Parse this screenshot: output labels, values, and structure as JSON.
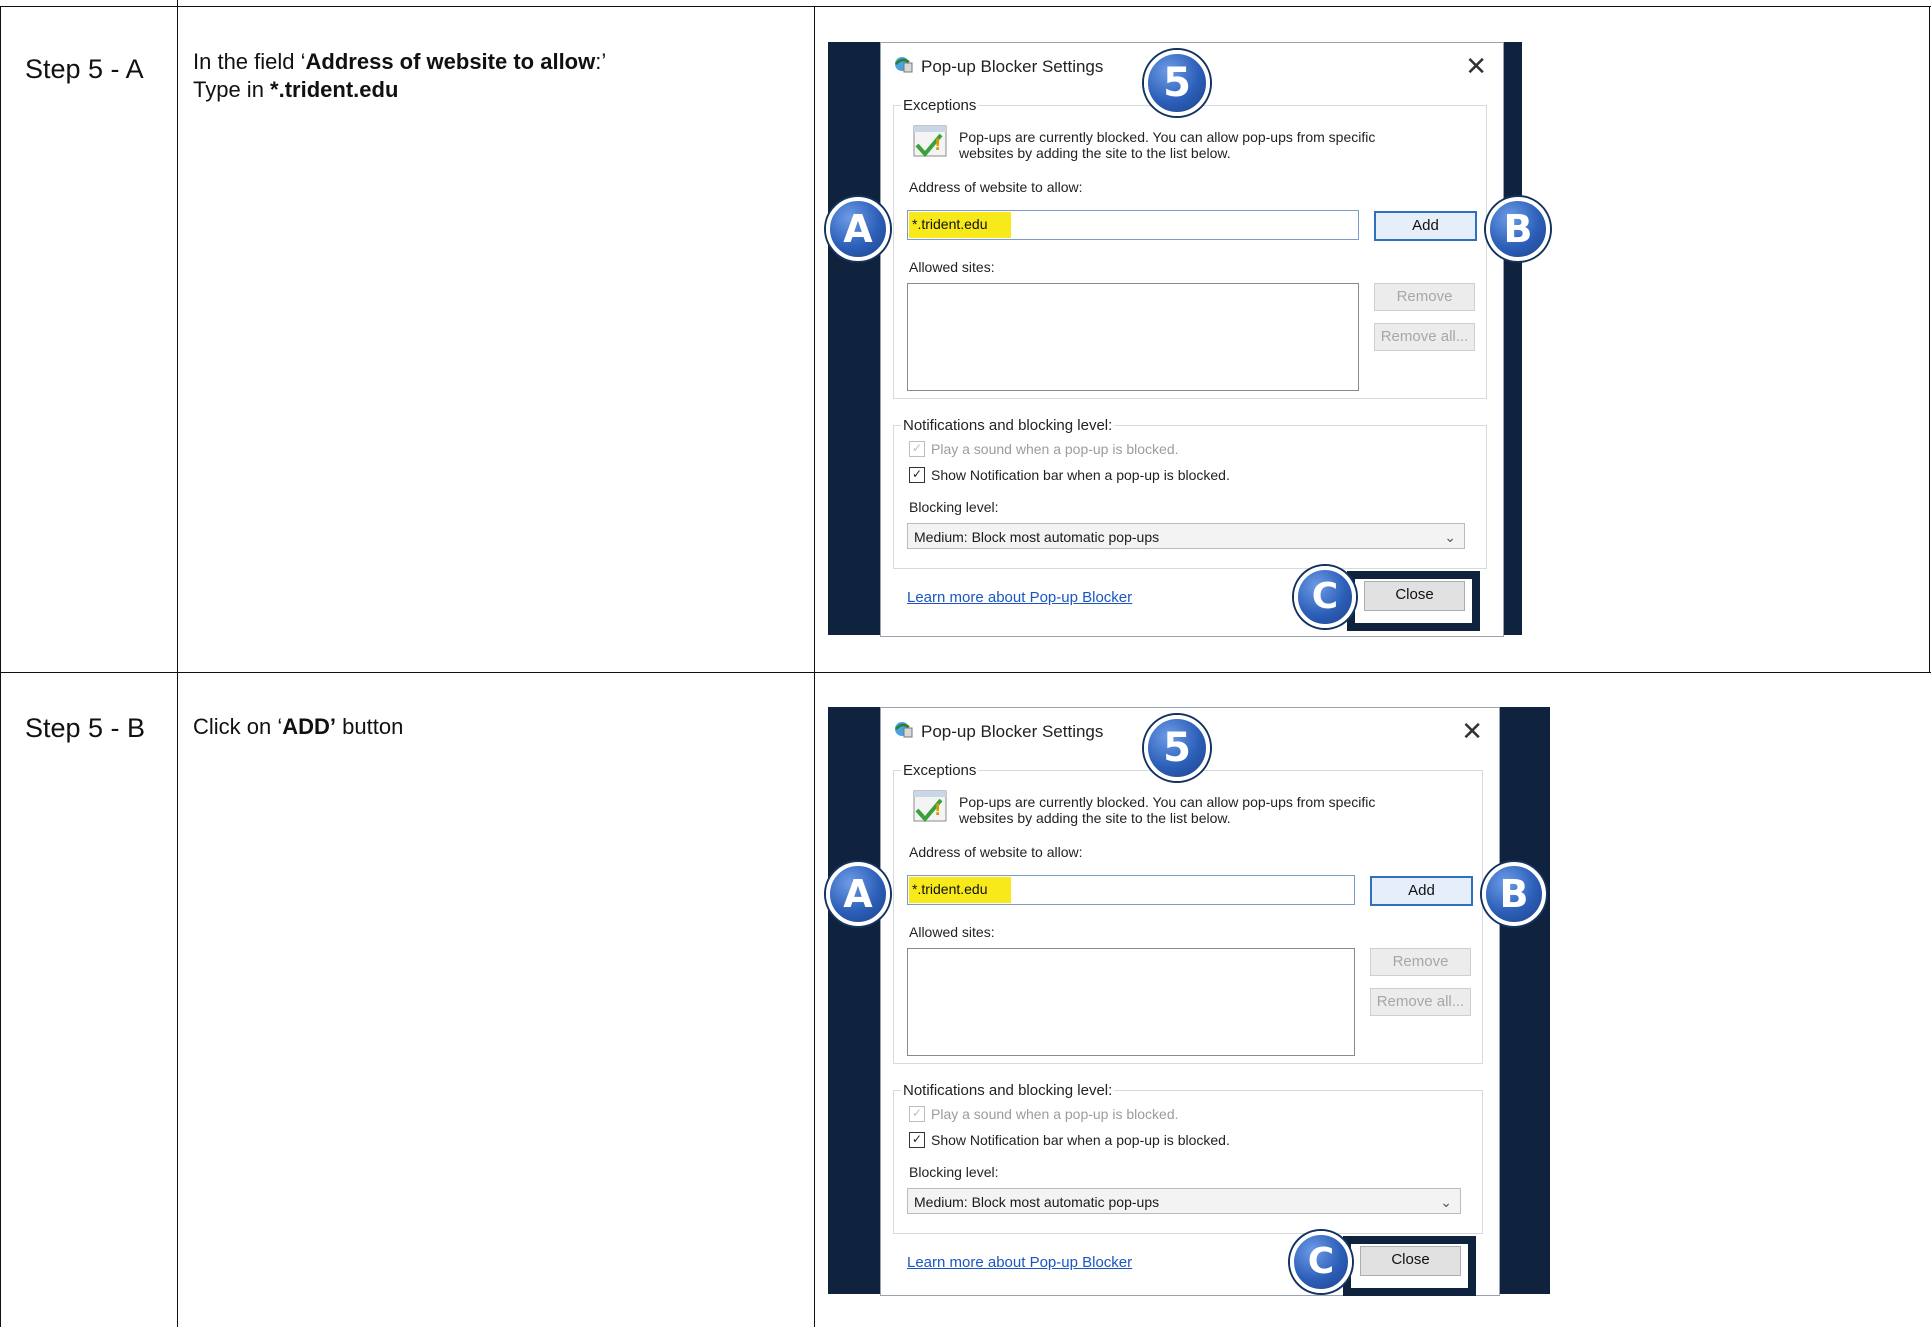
{
  "rows": [
    {
      "step": "Step 5 - A",
      "instr_line1_prefix": "In the field ‘",
      "instr_line1_bold": "Address of website to allow",
      "instr_line1_suffix": ":’",
      "instr_line2_prefix": "Type in ",
      "instr_line2_bold": "*.trident.edu"
    },
    {
      "step": "Step 5 - B",
      "instr_prefix": "Click on ‘",
      "instr_bold": "ADD’",
      "instr_suffix": " button"
    }
  ],
  "dialog": {
    "title": "Pop-up Blocker Settings",
    "close_glyph": "✕",
    "exceptions_label": "Exceptions",
    "info_line1": "Pop-ups are currently blocked.  You can allow pop-ups from specific",
    "info_line2": "websites by adding the site to the list below.",
    "address_label": "Address of website to allow:",
    "address_value": "*.trident.edu",
    "add_button": "Add",
    "allowed_sites_label": "Allowed sites:",
    "remove_button": "Remove",
    "remove_all_button": "Remove all...",
    "notifications_label": "Notifications and blocking level:",
    "play_sound_label": "Play a sound when a pop-up is blocked.",
    "show_notification_label": "Show Notification bar when a pop-up is blocked.",
    "blocking_level_label": "Blocking level:",
    "blocking_level_value": "Medium: Block most automatic pop-ups",
    "learn_more_link": "Learn more about Pop-up Blocker",
    "close_button": "Close",
    "checkmark": "✓",
    "chevron": "⌵"
  },
  "badges": {
    "step": "5",
    "a": "A",
    "b": "B",
    "c": "C"
  },
  "colors": {
    "highlight": "#f7e91a",
    "badge_blue": "#2c5fb8",
    "panel_navy": "#0f223e"
  }
}
